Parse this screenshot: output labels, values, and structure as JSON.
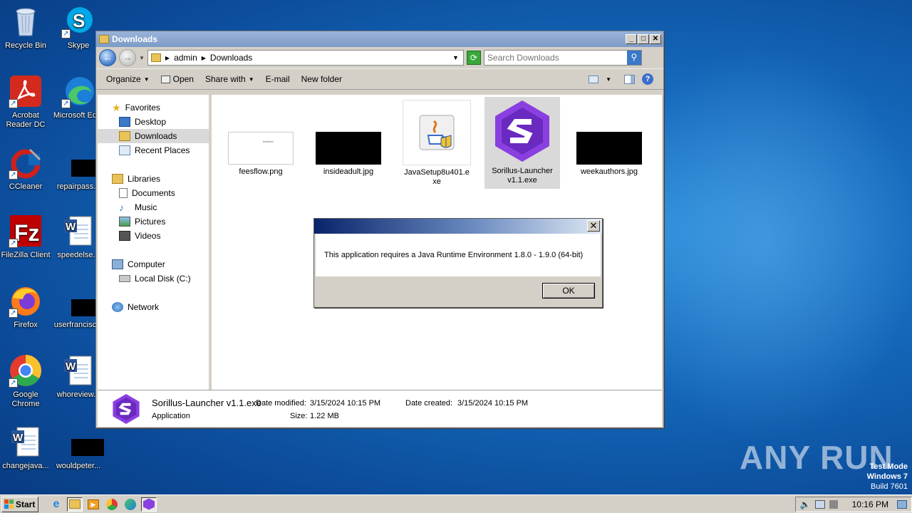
{
  "desktop": {
    "icons": [
      {
        "label": "Recycle Bin"
      },
      {
        "label": "Skype"
      },
      {
        "label": "Acrobat Reader DC"
      },
      {
        "label": "Microsoft Ed..."
      },
      {
        "label": "CCleaner"
      },
      {
        "label": "repairpass..."
      },
      {
        "label": "FileZilla Client"
      },
      {
        "label": "speedelse..."
      },
      {
        "label": "Firefox"
      },
      {
        "label": "userfrancisc..."
      },
      {
        "label": "Google Chrome"
      },
      {
        "label": "whoreview..."
      },
      {
        "label": "changejava..."
      },
      {
        "label": "wouldpeter..."
      }
    ]
  },
  "window": {
    "title": "Downloads",
    "breadcrumb": [
      "admin",
      "Downloads"
    ],
    "search_placeholder": "Search Downloads",
    "toolbar": {
      "organize": "Organize",
      "open": "Open",
      "share_with": "Share with",
      "email": "E-mail",
      "new_folder": "New folder"
    },
    "nav": {
      "favorites": "Favorites",
      "desktop": "Desktop",
      "downloads": "Downloads",
      "recent_places": "Recent Places",
      "libraries": "Libraries",
      "documents": "Documents",
      "music": "Music",
      "pictures": "Pictures",
      "videos": "Videos",
      "computer": "Computer",
      "local_disk": "Local Disk (C:)",
      "network": "Network"
    },
    "files": [
      {
        "name": "feesflow.png",
        "thumb_text": "feesflow"
      },
      {
        "name": "insideadult.jpg"
      },
      {
        "name": "JavaSetup8u401.exe"
      },
      {
        "name": "Sorillus-Launcher v1.1.exe"
      },
      {
        "name": "weekauthors.jpg"
      }
    ],
    "details": {
      "name": "Sorillus-Launcher v1.1.exe",
      "type": "Application",
      "date_modified_label": "Date modified:",
      "date_modified": "3/15/2024 10:15 PM",
      "size_label": "Size:",
      "size": "1.22 MB",
      "date_created_label": "Date created:",
      "date_created": "3/15/2024 10:15 PM"
    }
  },
  "dialog": {
    "message": "This application requires a Java Runtime Environment 1.8.0 - 1.9.0 (64-bit)",
    "ok": "OK"
  },
  "taskbar": {
    "start": "Start",
    "time": "10:16 PM"
  },
  "watermark": {
    "anyrun": "ANY RUN",
    "test_mode": "Test Mode",
    "os": "Windows 7",
    "build": "Build 7601"
  },
  "colors": {
    "sorillus_purple": "#8a3fe0",
    "desktop_blue": "#1466b8"
  }
}
